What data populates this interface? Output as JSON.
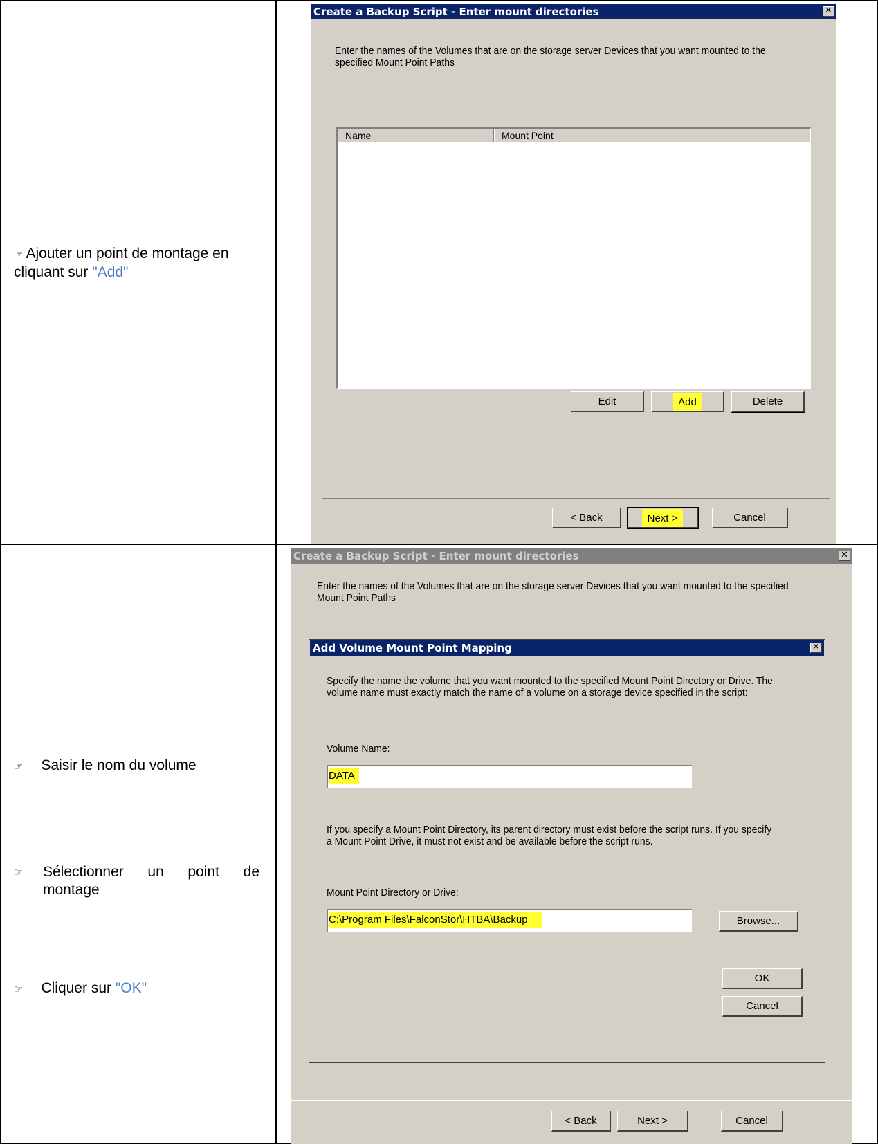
{
  "steps": {
    "add_mount": {
      "hand": "☞",
      "text_before": "Ajouter un point de montage en cliquant sur ",
      "quoted": "\"Add\""
    },
    "volume_name": {
      "hand": "☞",
      "text": "Saisir le nom du volume"
    },
    "select_mount": {
      "hand": "☞",
      "text": "Sélectionner un point de montage"
    },
    "click_ok": {
      "hand": "☞",
      "text_before": "Cliquer sur ",
      "quoted": "\"OK\""
    }
  },
  "dialog1": {
    "title": "Create a Backup Script - Enter mount directories",
    "close": "✕",
    "intro": "Enter the names of the Volumes that are on the storage server Devices that you want mounted to the specified Mount Point Paths",
    "columns": [
      "Name",
      "Mount Point"
    ],
    "buttons": {
      "edit": "Edit",
      "add": "Add",
      "delete": "Delete"
    },
    "nav": {
      "back": "< Back",
      "next": "Next >",
      "cancel": "Cancel"
    }
  },
  "dialog2": {
    "title": "Create a Backup Script - Enter mount directories",
    "close": "✕",
    "intro": "Enter the names of the Volumes that are on the storage server Devices that you want mounted to the specified Mount Point Paths",
    "nav": {
      "back": "< Back",
      "next": "Next >",
      "cancel": "Cancel"
    },
    "add_dialog": {
      "title": "Add Volume Mount Point Mapping",
      "close": "✕",
      "description": "Specify the name the volume that you want mounted to the specified Mount Point Directory or Drive. The volume name must exactly match the name of a volume on a storage device specified in the script:",
      "volume_label": "Volume Name:",
      "volume_value": "DATA",
      "note": "If you specify a Mount Point Directory, its parent directory must exist before the script runs. If you specify a Mount Point Drive, it must not exist and be available before the script runs.",
      "mount_label": "Mount Point Directory or Drive:",
      "mount_value": "C:\\Program Files\\FalconStor\\HTBA\\Backup",
      "browse": "Browse...",
      "ok": "OK",
      "cancel": "Cancel"
    }
  }
}
